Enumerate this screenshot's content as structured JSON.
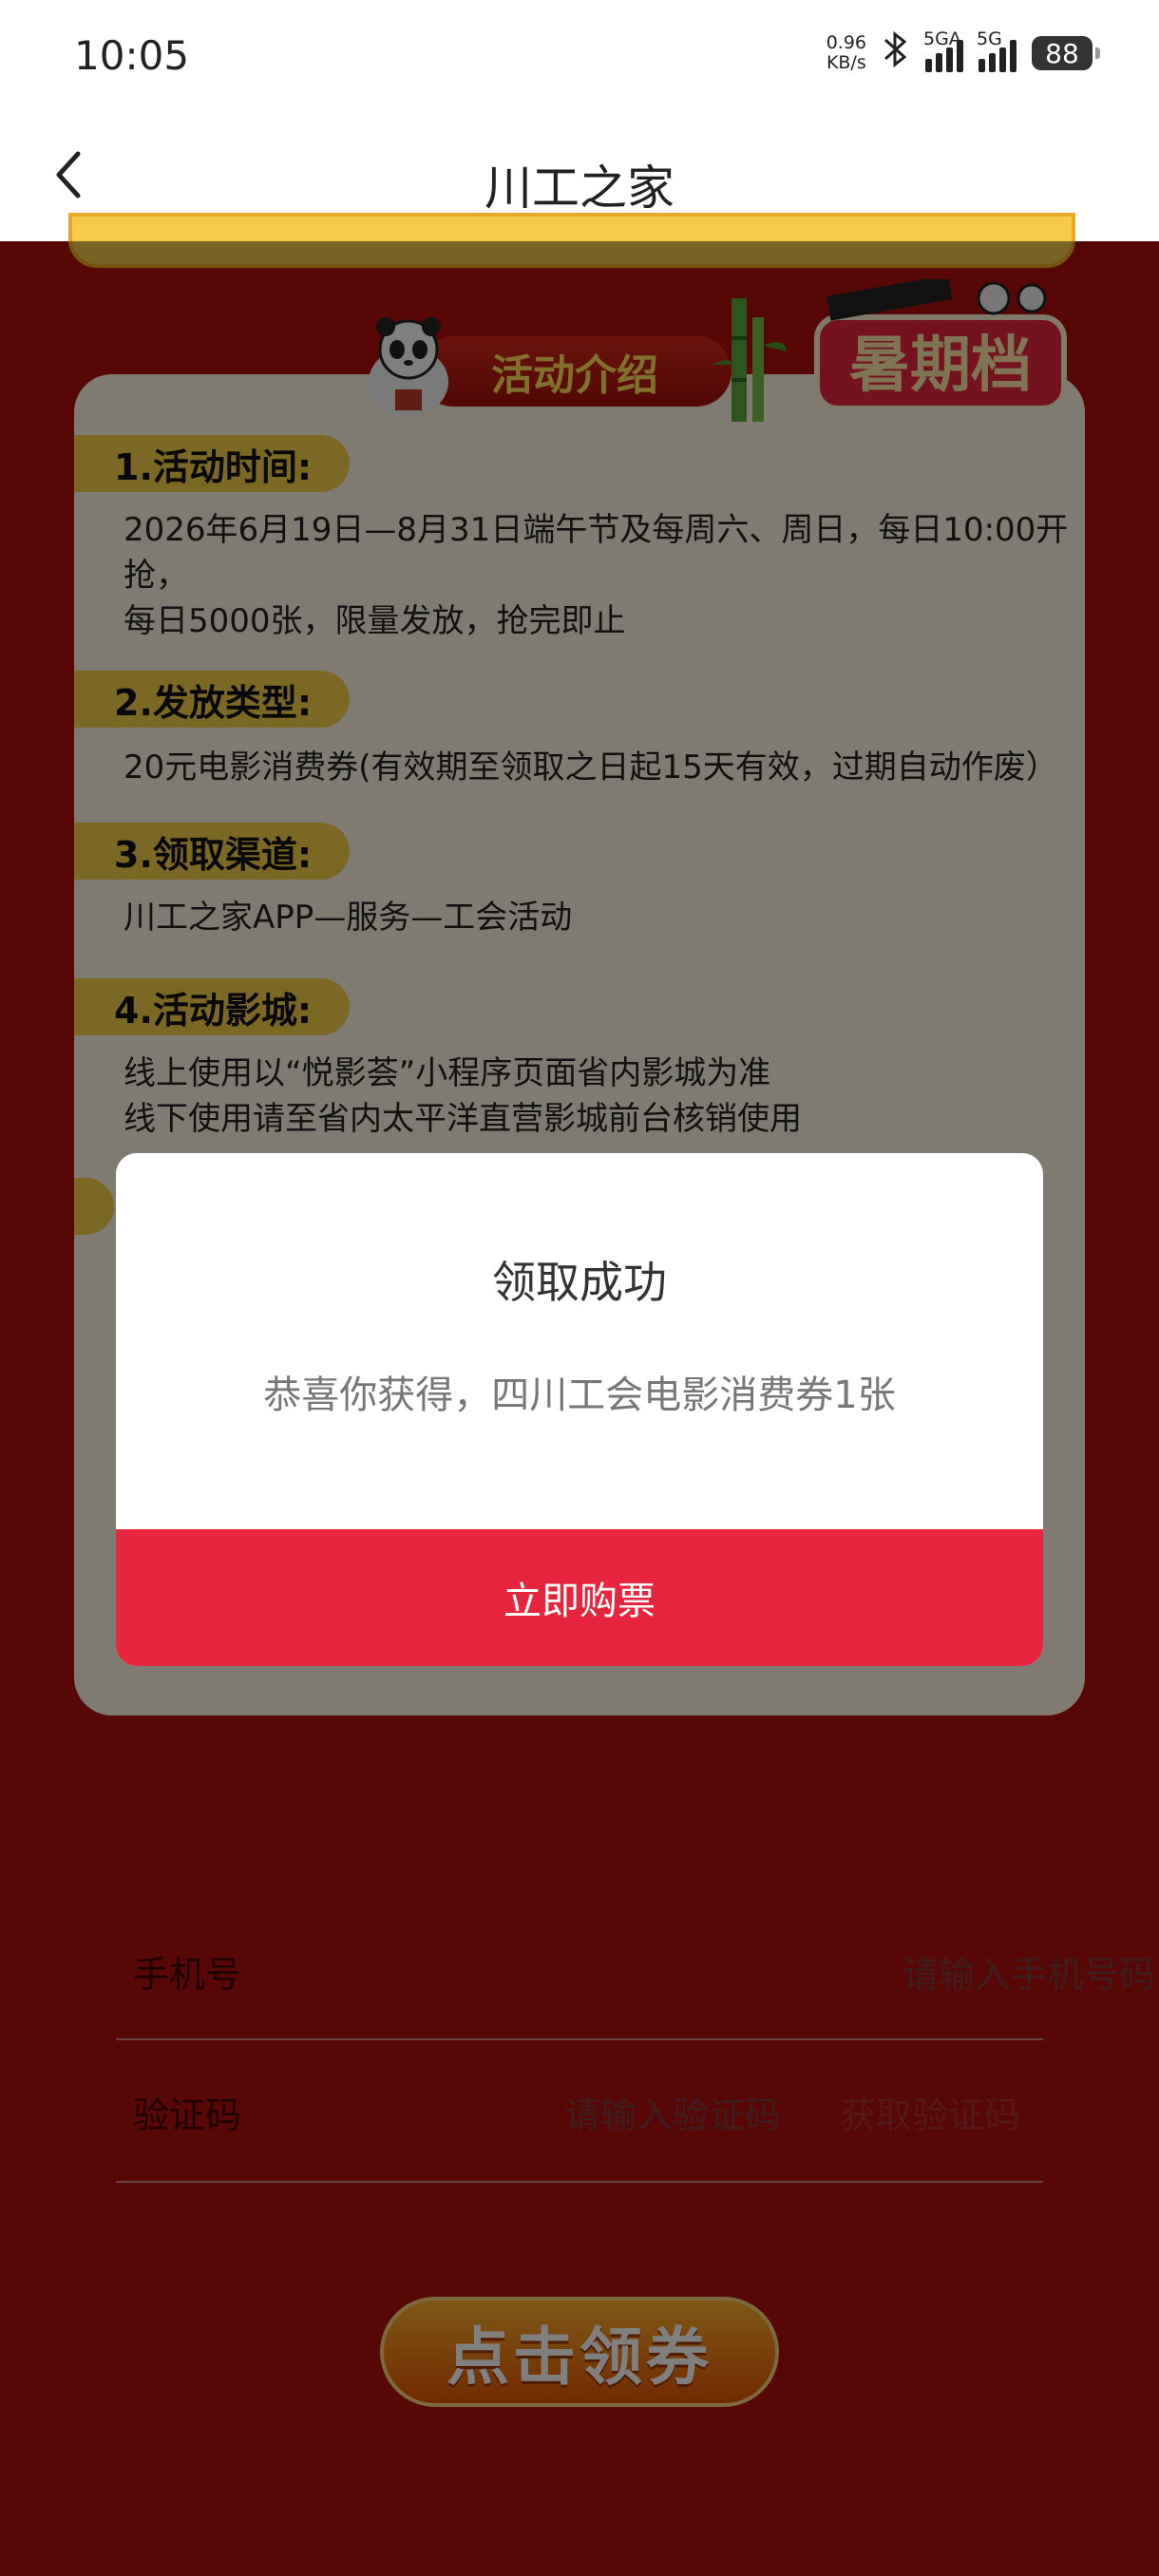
{
  "status_bar": {
    "time": "10:05",
    "net_speed_value": "0.96",
    "net_speed_unit": "KB/s",
    "sim1_label": "5GA",
    "sim2_label": "5G",
    "battery": "88",
    "icons": [
      "bluetooth-icon",
      "signal-icon",
      "battery-icon"
    ]
  },
  "header": {
    "title": "川工之家",
    "back_icon": "chevron-left-icon"
  },
  "intro": {
    "badge": "活动介绍",
    "summer_label": "暑期档",
    "sections": [
      {
        "label": "1.活动时间:",
        "lines": [
          "2026年6月19日—8月31日端午节及每周六、周日，每日10:00开抢，",
          "每日5000张，限量发放，抢完即止"
        ]
      },
      {
        "label": "2.发放类型:",
        "lines": [
          "20元电影消费券(有效期至领取之日起15天有效，过期自动作废）"
        ]
      },
      {
        "label": "3.领取渠道:",
        "lines": [
          "川工之家APP—服务—工会活动"
        ]
      },
      {
        "label": "4.活动影城:",
        "lines": [
          "线上使用以“悦影荟”小程序页面省内影城为准",
          "线下使用请至省内太平洋直营影城前台核销使用"
        ]
      }
    ]
  },
  "form": {
    "phone_label": "手机号",
    "phone_placeholder": "请输入手机号码",
    "code_label": "验证码",
    "code_placeholder": "请输入验证码",
    "get_code": "获取验证码",
    "claim_button": "点击领券"
  },
  "dialog": {
    "title": "领取成功",
    "message": "恭喜你获得，四川工会电影消费券1张",
    "button": "立即购票"
  },
  "colors": {
    "page_bg": "#b10e0e",
    "dialog_button": "#e8253f",
    "section_label": "#f7d04a"
  }
}
